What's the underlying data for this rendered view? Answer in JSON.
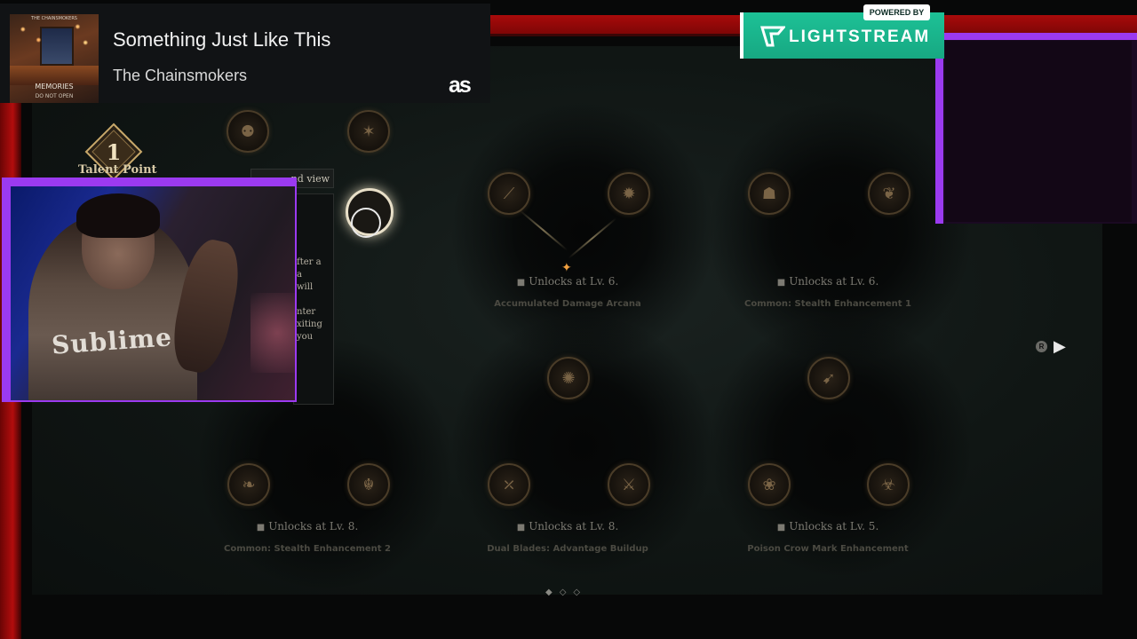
{
  "music": {
    "song_title": "Something Just Like This",
    "artist": "The Chainsmokers",
    "album_top_text": "THE CHAINSMOKERS",
    "album_title": "MEMORIES",
    "album_subtitle": "DO NOT OPEN",
    "service_logo": "as"
  },
  "stream": {
    "powered_by": "POWERED BY",
    "brand": "LIGHTSTREAM",
    "accent_red": "#a80a0a",
    "accent_purple": "#9b3af0",
    "accent_green": "#1dc196"
  },
  "game": {
    "talent_points": "1",
    "talent_label": "Talent Point",
    "expand_button": "nd view",
    "tooltip_lines": [
      "fter a",
      "a",
      "will",
      "",
      "nter",
      "xiting",
      "you"
    ],
    "tooltip_highlight": "a",
    "groups": [
      {
        "unlock": "Unlocks at Lv. 6.",
        "name": "Accumulated Damage Arcana"
      },
      {
        "unlock": "Unlocks at Lv. 6.",
        "name": "Common: Stealth Enhancement 1"
      },
      {
        "unlock": "Unlocks at Lv. 8.",
        "name": "Common: Stealth Enhancement 2"
      },
      {
        "unlock": "Unlocks at Lv. 8.",
        "name": "Dual Blades: Advantage Buildup"
      },
      {
        "unlock": "Unlocks at Lv. 5.",
        "name": "Poison Crow Mark Enhancement"
      }
    ],
    "nav_key": "R",
    "pager": "◆◇◇"
  }
}
